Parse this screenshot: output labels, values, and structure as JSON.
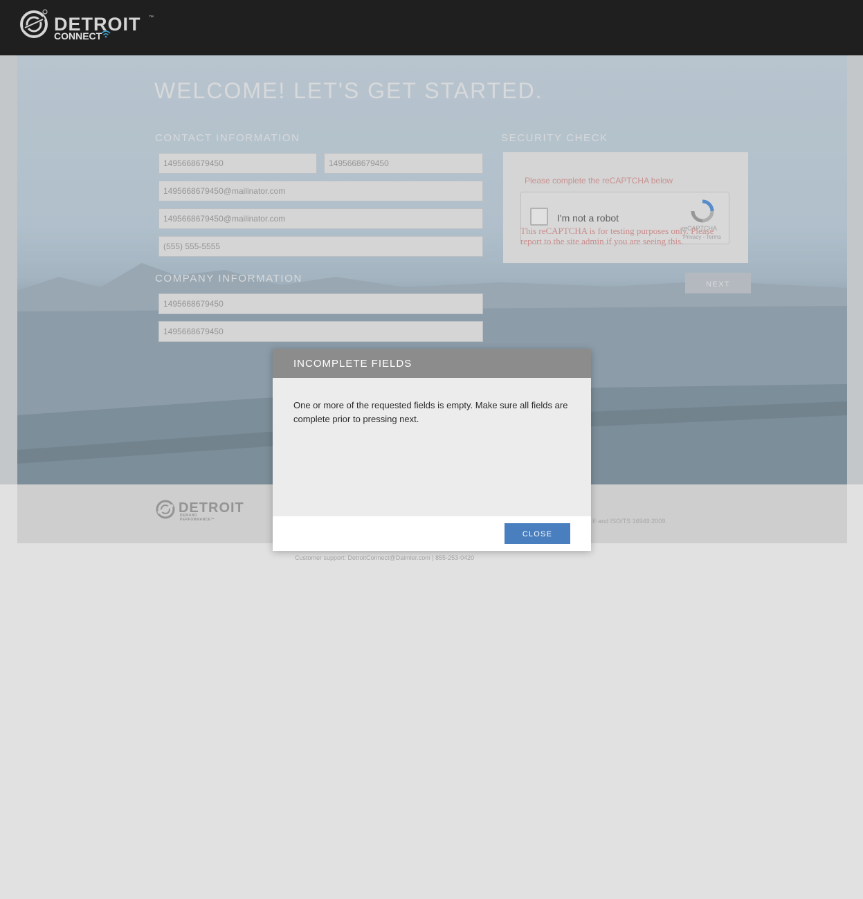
{
  "header": {
    "brand": "DETROIT",
    "trademark": "™",
    "sub_brand": "CONNECT"
  },
  "main": {
    "title": "WELCOME! LET'S GET STARTED.",
    "contact": {
      "heading": "CONTACT INFORMATION",
      "first_name": "1495668679450",
      "last_name": "1495668679450",
      "email": "1495668679450@mailinator.com",
      "confirm_email": "1495668679450@mailinator.com",
      "phone": "(555) 555-5555"
    },
    "company": {
      "heading": "COMPANY INFORMATION",
      "company_name": "1495668679450",
      "company_id": "1495668679450"
    },
    "security": {
      "heading": "SECURITY CHECK",
      "message": "Please complete the reCAPTCHA below",
      "recaptcha_label": "I'm not a robot",
      "recaptcha_brand": "reCAPTCHA",
      "recaptcha_links": "Privacy - Terms",
      "recaptcha_warning": "This reCAPTCHA is for testing purposes only. Please report to the site admin if you are seeing this."
    },
    "next_label": "NEXT"
  },
  "footer": {
    "brand": "DETROIT",
    "tagline": "DEMAND PERFORMANCE™",
    "iso_text": "® and ISO/TS 16949:2009.",
    "support_text": "Customer support: DetroitConnect@Daimler.com | 855-253-0420"
  },
  "modal": {
    "title": "INCOMPLETE FIELDS",
    "message": "One or more of the requested fields is empty. Make sure all fields are complete prior to pressing next.",
    "close_label": "CLOSE"
  },
  "colors": {
    "header_bg": "#000000",
    "modal_header": "#8c8c8c",
    "close_button": "#4a7fbf",
    "captcha_message": "#e19696"
  }
}
